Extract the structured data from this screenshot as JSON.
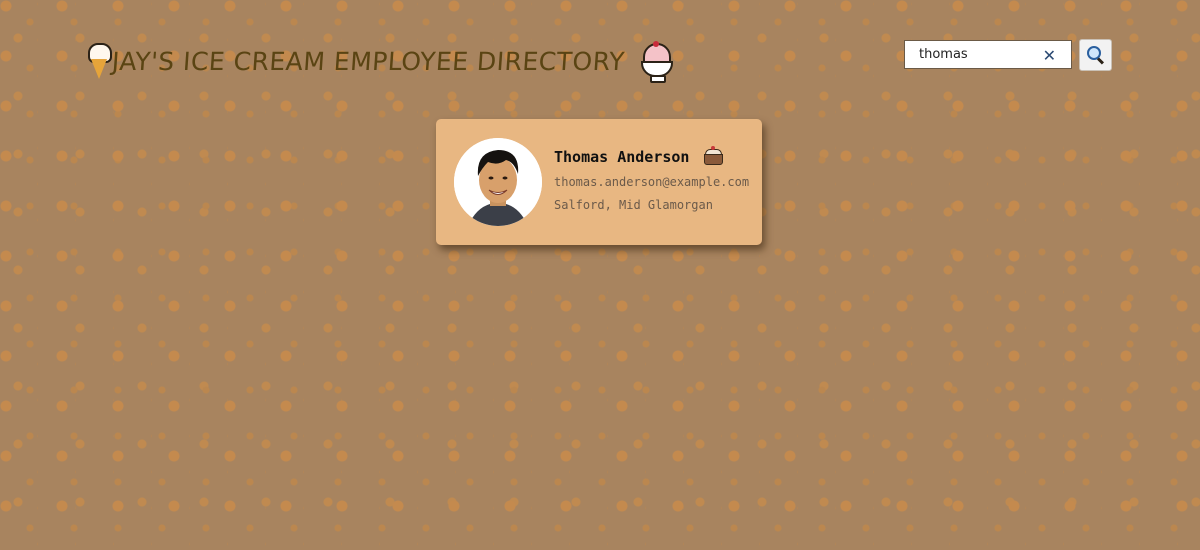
{
  "header": {
    "title": "JAY'S ICE CREAM EMPLOYEE DIRECTORY",
    "left_icon": "ice-cream-cone-icon",
    "right_icon": "shaved-ice-icon"
  },
  "search": {
    "value": "thomas",
    "clear_icon": "close-icon",
    "button_icon": "search-icon"
  },
  "employees": [
    {
      "name": "Thomas Anderson",
      "name_icon": "cake-icon",
      "email": "thomas.anderson@example.com",
      "location": "Salford, Mid Glamorgan"
    }
  ],
  "colors": {
    "background": "#a8845f",
    "card": "#e8b782",
    "title": "#5a4413"
  }
}
